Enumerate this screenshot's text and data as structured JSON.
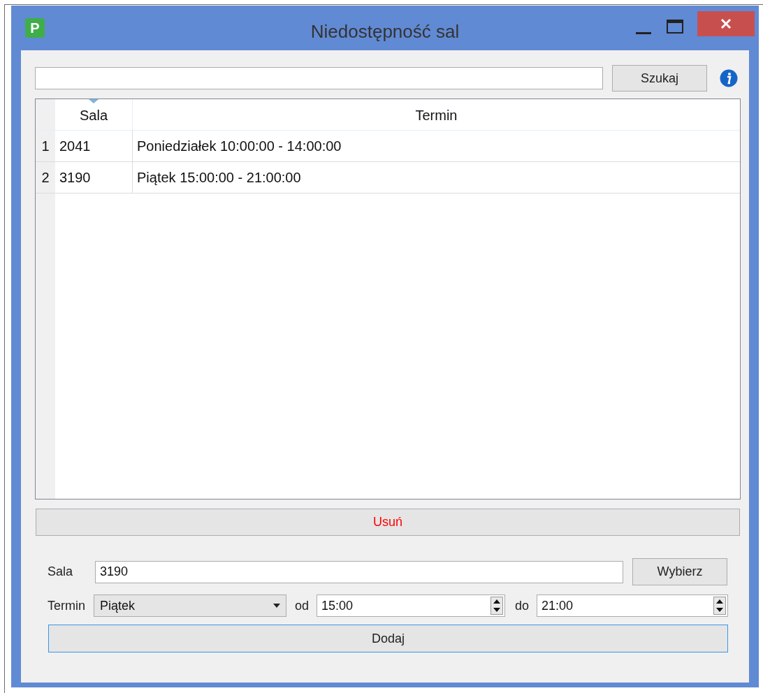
{
  "window": {
    "title": "Niedostępność sal",
    "icon_letter": "P"
  },
  "search": {
    "button": "Szukaj"
  },
  "table": {
    "columns": [
      {
        "label": "Sala",
        "sorted": true
      },
      {
        "label": "Termin",
        "sorted": false
      }
    ],
    "rows": [
      {
        "number": "1",
        "cells": [
          "2041",
          "Poniedziałek 10:00:00 - 14:00:00"
        ]
      },
      {
        "number": "2",
        "cells": [
          "3190",
          "Piątek 15:00:00 - 21:00:00"
        ]
      }
    ]
  },
  "delete_button": "Usuń",
  "form": {
    "sala_label": "Sala",
    "sala_value": "3190",
    "choose_button": "Wybierz",
    "termin_label": "Termin",
    "day": "Piątek",
    "from_label": "od",
    "from_value": "15:00",
    "to_label": "do",
    "to_value": "21:00",
    "add_button": "Dodaj"
  }
}
